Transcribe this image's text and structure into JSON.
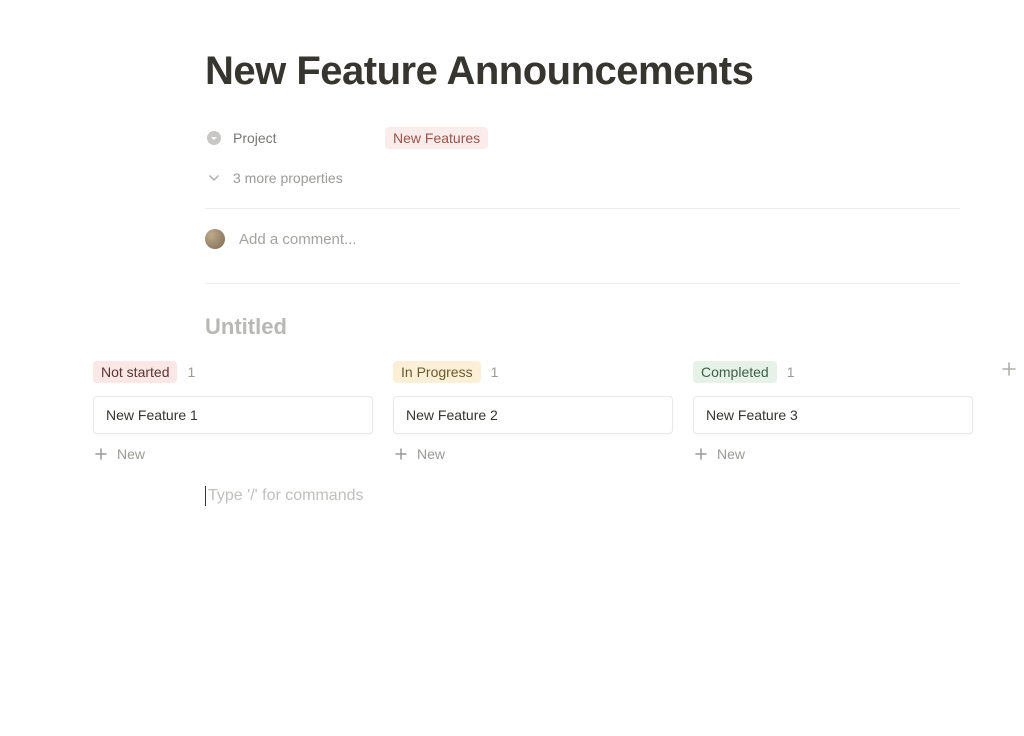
{
  "page": {
    "title": "New Feature Announcements"
  },
  "properties": {
    "project": {
      "label": "Project",
      "value": "New Features"
    },
    "more_label": "3 more properties"
  },
  "comments": {
    "placeholder": "Add a comment..."
  },
  "database": {
    "title": "Untitled",
    "columns": [
      {
        "status": "Not started",
        "style": "red",
        "count": "1",
        "cards": [
          "New Feature 1"
        ],
        "new_label": "New"
      },
      {
        "status": "In Progress",
        "style": "yellow",
        "count": "1",
        "cards": [
          "New Feature 2"
        ],
        "new_label": "New"
      },
      {
        "status": "Completed",
        "style": "green",
        "count": "1",
        "cards": [
          "New Feature 3"
        ],
        "new_label": "New"
      }
    ]
  },
  "editor": {
    "slash_hint": "Type '/' for commands"
  }
}
